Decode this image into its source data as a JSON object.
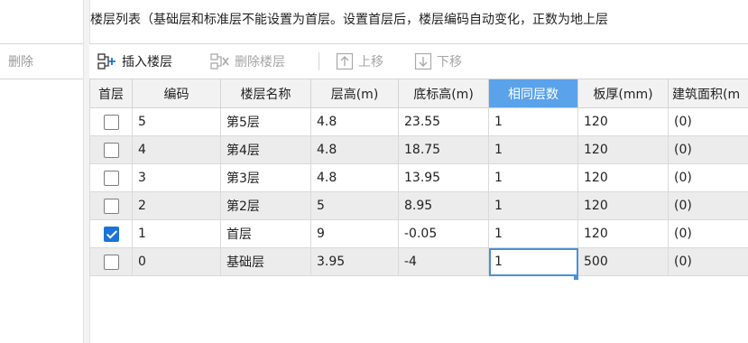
{
  "left": {
    "delete_label": "删除"
  },
  "title": "楼层列表（基础层和标准层不能设置为首层。设置首层后，楼层编码自动变化，正数为地上层",
  "toolbar": {
    "insert_label": "插入楼层",
    "delete_label": "删除楼层",
    "up_label": "上移",
    "down_label": "下移"
  },
  "table": {
    "columns": [
      "首层",
      "编码",
      "楼层名称",
      "层高(m)",
      "底标高(m)",
      "相同层数",
      "板厚(mm)",
      "建筑面积(m"
    ],
    "rows": [
      {
        "first": false,
        "code": "5",
        "name": "第5层",
        "height": "4.8",
        "base": "23.55",
        "same": "1",
        "slab": "120",
        "area": "(0)"
      },
      {
        "first": false,
        "code": "4",
        "name": "第4层",
        "height": "4.8",
        "base": "18.75",
        "same": "1",
        "slab": "120",
        "area": "(0)"
      },
      {
        "first": false,
        "code": "3",
        "name": "第3层",
        "height": "4.8",
        "base": "13.95",
        "same": "1",
        "slab": "120",
        "area": "(0)"
      },
      {
        "first": false,
        "code": "2",
        "name": "第2层",
        "height": "5",
        "base": "8.95",
        "same": "1",
        "slab": "120",
        "area": "(0)"
      },
      {
        "first": true,
        "code": "1",
        "name": "首层",
        "height": "9",
        "base": "-0.05",
        "same": "1",
        "slab": "120",
        "area": "(0)"
      },
      {
        "first": false,
        "code": "0",
        "name": "基础层",
        "height": "3.95",
        "base": "-4",
        "same": "1",
        "slab": "500",
        "area": "(0)"
      }
    ]
  },
  "colors": {
    "accent": "#1a73d9",
    "header_highlight": "#5aa2ea",
    "selection": "#4c8fd6"
  }
}
